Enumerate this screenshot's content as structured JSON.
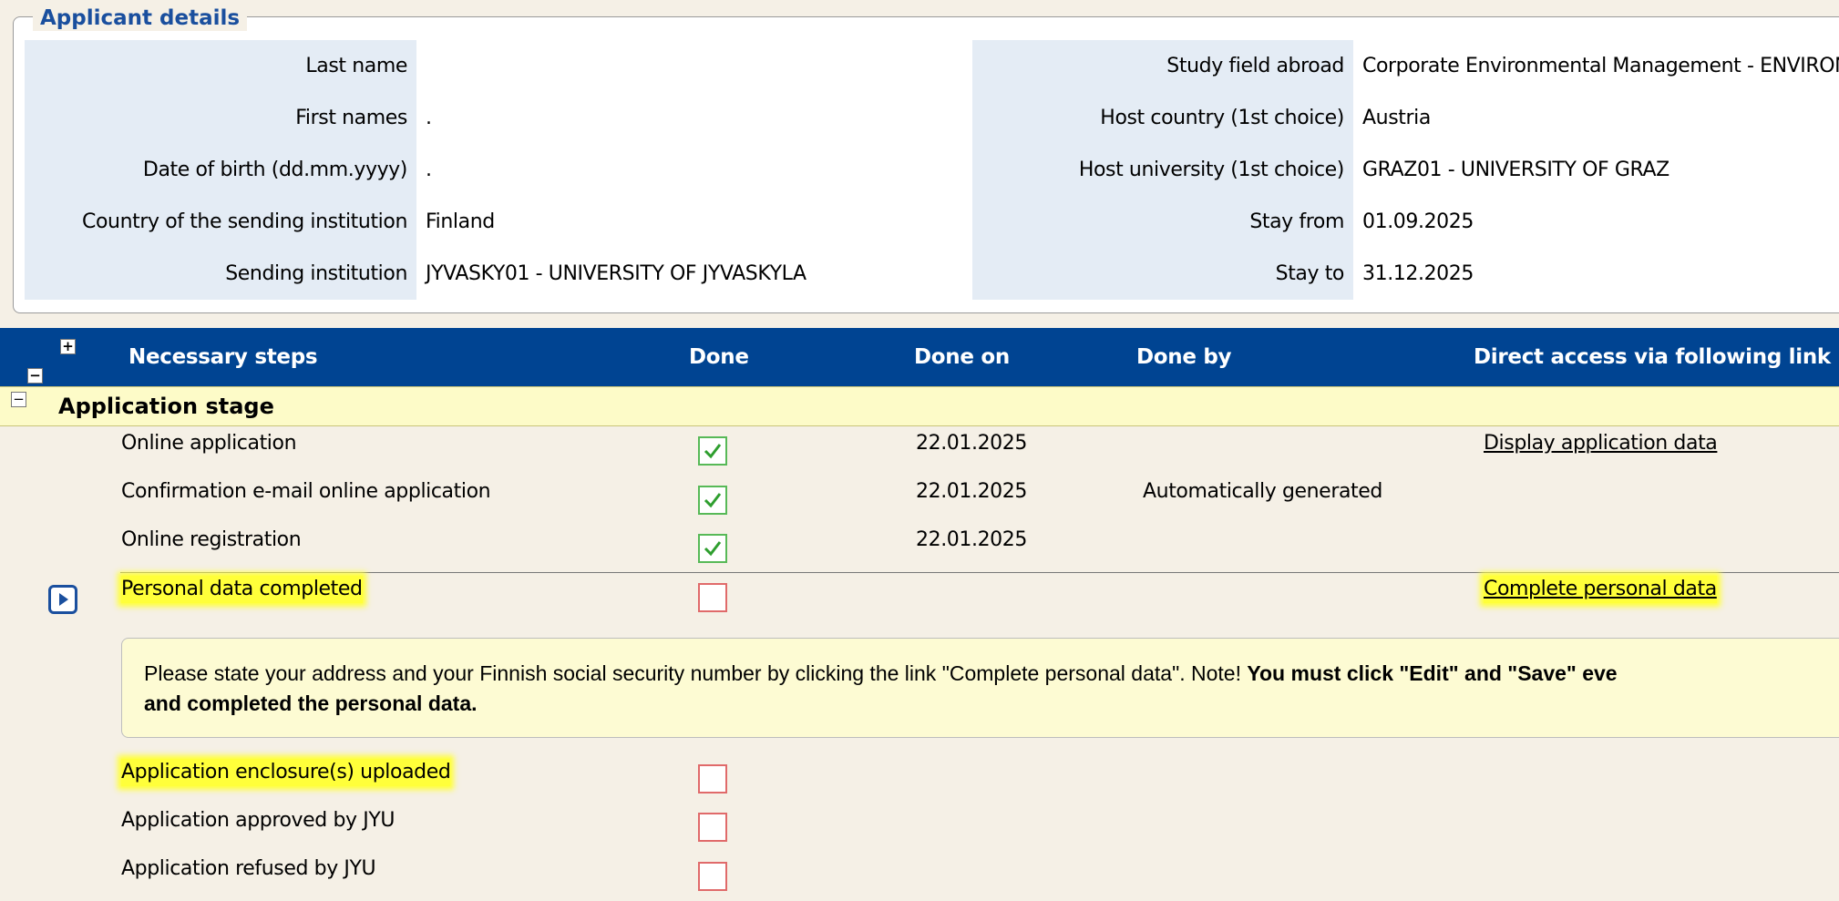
{
  "applicant": {
    "legend": "Applicant details",
    "left": [
      {
        "label": "Last name",
        "value": ""
      },
      {
        "label": "First names",
        "value": "."
      },
      {
        "label": "Date of birth (dd.mm.yyyy)",
        "value": "."
      },
      {
        "label": "Country of the sending institution",
        "value": "Finland"
      },
      {
        "label": "Sending institution",
        "value": "JYVASKY01 - UNIVERSITY OF JYVASKYLA"
      }
    ],
    "right": [
      {
        "label": "Study field abroad",
        "value": "Corporate Environmental Management - ENVIRON"
      },
      {
        "label": "Host country (1st choice)",
        "value": "Austria"
      },
      {
        "label": "Host university (1st choice)",
        "value": "GRAZ01 - UNIVERSITY OF GRAZ"
      },
      {
        "label": "Stay from",
        "value": "01.09.2025"
      },
      {
        "label": "Stay to",
        "value": "31.12.2025"
      }
    ]
  },
  "table": {
    "headers": {
      "steps": "Necessary steps",
      "done": "Done",
      "done_on": "Done on",
      "done_by": "Done by",
      "link": "Direct access via following link"
    },
    "stage_label": "Application stage",
    "steps": [
      {
        "name": "Online application",
        "done_on": "22.01.2025",
        "done_by": "",
        "link": "Display application data"
      },
      {
        "name": "Confirmation e-mail online application",
        "done_on": "22.01.2025",
        "done_by": "Automatically generated",
        "link": ""
      },
      {
        "name": "Online registration",
        "done_on": "22.01.2025",
        "done_by": "",
        "link": ""
      },
      {
        "name": "Personal data completed",
        "done_on": "",
        "done_by": "",
        "link": "Complete personal data"
      },
      {
        "name": "Application enclosure(s) uploaded",
        "done_on": "",
        "done_by": "",
        "link": ""
      },
      {
        "name": "Application approved by JYU",
        "done_on": "",
        "done_by": "",
        "link": ""
      },
      {
        "name": "Application refused by JYU",
        "done_on": "",
        "done_by": "",
        "link": ""
      }
    ],
    "note": {
      "text_plain": "Please state your address and your Finnish social security number by clicking the link \"Complete personal data\". Note! ",
      "text_bold_1": "You must click \"Edit\" and \"Save\" eve",
      "text_bold_2": "and completed the personal data."
    }
  },
  "colors": {
    "header_bg": "#004492",
    "label_bg": "#e4ecf5",
    "stage_bg": "#fdfbc8",
    "highlight": "#ffff3a",
    "check_green": "#57b957",
    "check_red": "#e06a6a"
  }
}
